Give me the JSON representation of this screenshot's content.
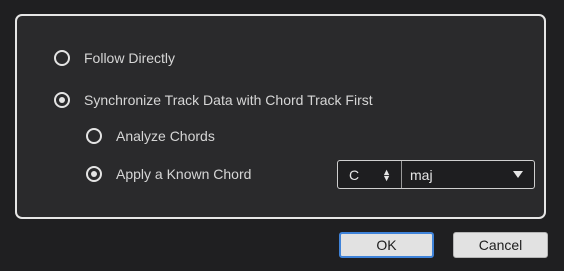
{
  "options": {
    "follow_directly": {
      "label": "Follow Directly",
      "checked": false
    },
    "synchronize": {
      "label": "Synchronize Track Data with Chord Track First",
      "checked": true
    },
    "analyze_chords": {
      "label": "Analyze Chords",
      "checked": false
    },
    "apply_known_chord": {
      "label": "Apply a Known Chord",
      "checked": true
    }
  },
  "chord": {
    "root": "C",
    "type": "maj"
  },
  "buttons": {
    "ok": "OK",
    "cancel": "Cancel"
  },
  "icons": {
    "stepper_up": "▲",
    "stepper_down": "▼"
  }
}
